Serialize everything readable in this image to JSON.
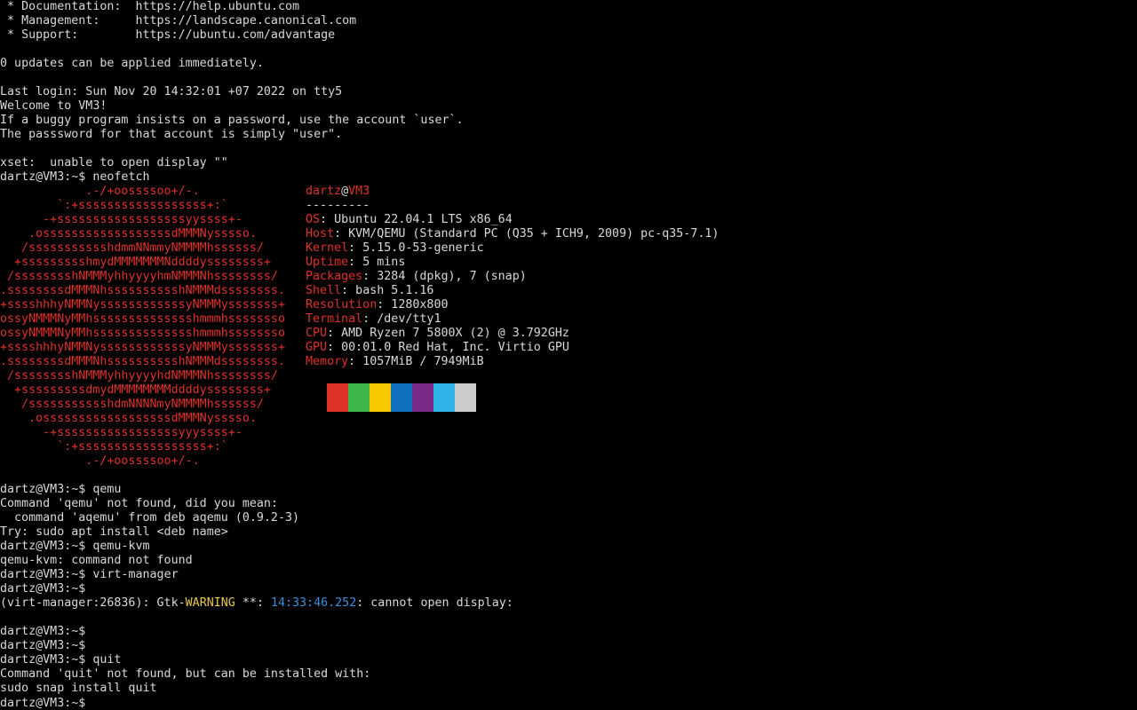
{
  "motd": {
    "doc_line": " * Documentation:  https://help.ubuntu.com",
    "mgmt_line": " * Management:     https://landscape.canonical.com",
    "support_line": " * Support:        https://ubuntu.com/advantage",
    "updates_line": "0 updates can be applied immediately.",
    "last_login": "Last login: Sun Nov 20 14:32:01 +07 2022 on tty5",
    "welcome": "Welcome to VM3!",
    "buggy_line": "If a buggy program insists on a password, use the account `user`.",
    "password_line": "The passsword for that account is simply \"user\".",
    "xset_line": "xset:  unable to open display \"\""
  },
  "prompt": "dartz@VM3:~$ ",
  "commands": {
    "neofetch": "neofetch",
    "qemu": "qemu",
    "qemu_kvm": "qemu-kvm",
    "virt_manager": "virt-manager",
    "quit": "quit"
  },
  "ascii_logo": [
    [
      "            ",
      ".-/+oossssoo+/-."
    ],
    [
      "        ",
      "`:+ssssssssssssssssss+:`"
    ],
    [
      "      ",
      "-+ssssssssssssssssssyyssss+-"
    ],
    [
      "    ",
      ".ossssssssssssssssssdMMMNysssso."
    ],
    [
      "   ",
      "/ssssssssssshdmmNNmmyNMMMMhssssss/"
    ],
    [
      "  ",
      "+ssssssssshmydMMMMMMMNddddyssssssss+"
    ],
    [
      " ",
      "/sssssssshNMMMyhhyyyyhmNMMMNhssssssss/"
    ],
    [
      "",
      ".ssssssssdMMMNhsssssssssshNMMMdssssssss."
    ],
    [
      "",
      "+sssshhhyNMMNyssssssssssssyNMMMysssssss+"
    ],
    [
      "",
      "ossyNMMMNyMMhsssssssssssssshmmmhssssssso"
    ],
    [
      "",
      "ossyNMMMNyMMhsssssssssssssshmmmhssssssso"
    ],
    [
      "",
      "+sssshhhyNMMNyssssssssssssyNMMMysssssss+"
    ],
    [
      "",
      ".ssssssssdMMMNhsssssssssshNMMMdssssssss."
    ],
    [
      " ",
      "/sssssssshNMMMyhhyyyyhdNMMMNhssssssss/"
    ],
    [
      "  ",
      "+sssssssssdmydMMMMMMMMddddyssssssss+"
    ],
    [
      "   ",
      "/ssssssssssshdmNNNNmyNMMMMhssssss/"
    ],
    [
      "    ",
      ".ossssssssssssssssssdMMMNysssso."
    ],
    [
      "      ",
      "-+sssssssssssssssssyyyssss+-"
    ],
    [
      "        ",
      "`:+ssssssssssssssssss+:`"
    ],
    [
      "            ",
      ".-/+oossssoo+/-."
    ]
  ],
  "sysinfo": {
    "user": "dartz",
    "at": "@",
    "host": "VM3",
    "separator": "---------",
    "rows": [
      {
        "key": "OS",
        "value": ": Ubuntu 22.04.1 LTS x86_64"
      },
      {
        "key": "Host",
        "value": ": KVM/QEMU (Standard PC (Q35 + ICH9, 2009) pc-q35-7.1)"
      },
      {
        "key": "Kernel",
        "value": ": 5.15.0-53-generic"
      },
      {
        "key": "Uptime",
        "value": ": 5 mins"
      },
      {
        "key": "Packages",
        "value": ": 3284 (dpkg), 7 (snap)"
      },
      {
        "key": "Shell",
        "value": ": bash 5.1.16"
      },
      {
        "key": "Resolution",
        "value": ": 1280x800"
      },
      {
        "key": "Terminal",
        "value": ": /dev/tty1"
      },
      {
        "key": "CPU",
        "value": ": AMD Ryzen 7 5800X (2) @ 3.792GHz"
      },
      {
        "key": "GPU",
        "value": ": 00:01.0 Red Hat, Inc. Virtio GPU"
      },
      {
        "key": "Memory",
        "value": ": 1057MiB / 7949MiB"
      }
    ]
  },
  "palette": [
    "#e0302a",
    "#3cb64a",
    "#fac800",
    "#1070c0",
    "#7a2a88",
    "#30b4e8",
    "#cccccc"
  ],
  "output": {
    "qemu_not_found": "Command 'qemu' not found, did you mean:",
    "qemu_suggest": "  command 'aqemu' from deb aqemu (0.9.2-3)",
    "try_line": "Try: sudo apt install <deb name>",
    "qemu_kvm_not_found": "qemu-kvm: command not found",
    "gtk_prefix": "(virt-manager:26836): Gtk-",
    "gtk_warning": "WARNING",
    "gtk_stars": " **: ",
    "gtk_time": "14:33:46.252",
    "gtk_msg": ": cannot open display:",
    "quit_not_found": "Command 'quit' not found, but can be installed with:",
    "quit_install": "sudo snap install quit"
  }
}
